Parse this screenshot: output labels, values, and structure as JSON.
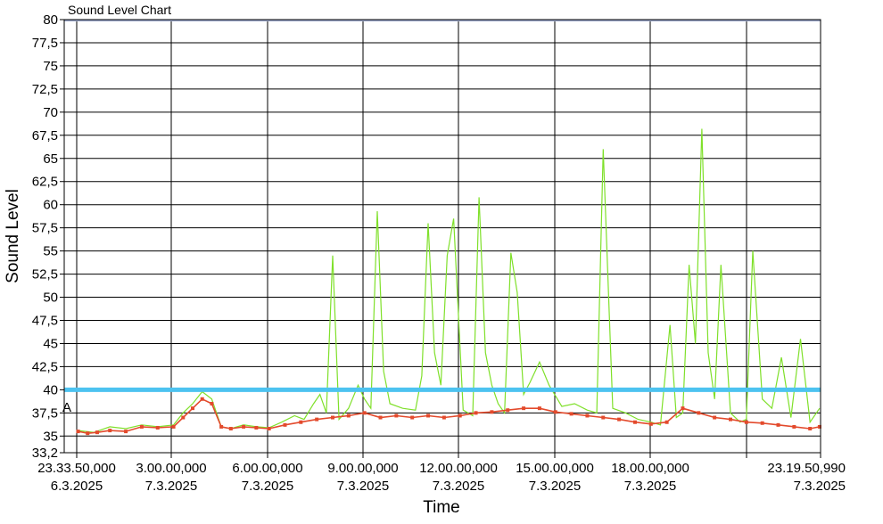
{
  "chart_data": {
    "type": "line",
    "title": "Sound Level Chart",
    "xlabel": "Time",
    "ylabel": "Sound Level",
    "ylim": [
      33.2,
      80
    ],
    "y_ticks": [
      "80",
      "77,5",
      "75",
      "72,5",
      "70",
      "67,5",
      "65",
      "62,5",
      "60",
      "57,5",
      "55",
      "52,5",
      "50",
      "47,5",
      "45",
      "42,5",
      "40",
      "37,5",
      "35",
      "33,2"
    ],
    "x_range_hours": [
      -0.4361,
      23.3308
    ],
    "x_ticks": [
      {
        "time": "23.33.50,000",
        "date": "6.3.2025"
      },
      {
        "time": "3.00.00,000",
        "date": "7.3.2025"
      },
      {
        "time": "6.00.00,000",
        "date": "7.3.2025"
      },
      {
        "time": "9.00.00,000",
        "date": "7.3.2025"
      },
      {
        "time": "12.00.00,000",
        "date": "7.3.2025"
      },
      {
        "time": "15.00.00,000",
        "date": "7.3.2025"
      },
      {
        "time": "18.00.00,000",
        "date": "7.3.2025"
      },
      {
        "time": "",
        "date": ""
      },
      {
        "time": "23.19.50,990",
        "date": "7.3.2025"
      }
    ],
    "threshold": {
      "value": 40,
      "color": "#4dc3f0"
    },
    "marker_label": "A",
    "series": [
      {
        "color": "#7fe02a",
        "x": [
          0,
          0.5,
          1,
          1.5,
          2,
          2.5,
          3,
          3.3,
          3.6,
          3.9,
          4.2,
          4.5,
          4.8,
          5.2,
          5.6,
          6.0,
          6.4,
          6.8,
          7.1,
          7.4,
          7.6,
          7.8,
          8.0,
          8.2,
          8.5,
          8.8,
          9.0,
          9.2,
          9.4,
          9.6,
          9.8,
          10.2,
          10.6,
          10.8,
          11.0,
          11.2,
          11.4,
          11.6,
          11.8,
          12.1,
          12.4,
          12.6,
          12.8,
          13.0,
          13.2,
          13.4,
          13.6,
          13.8,
          14.0,
          14.2,
          14.5,
          14.8,
          15.2,
          15.6,
          16.0,
          16.3,
          16.5,
          16.8,
          17.2,
          17.6,
          18.0,
          18.3,
          18.6,
          18.8,
          19.0,
          19.2,
          19.4,
          19.6,
          19.8,
          20.0,
          20.2,
          20.5,
          20.8,
          21.0,
          21.2,
          21.5,
          21.8,
          22.1,
          22.4,
          22.7,
          23.0,
          23.3
        ],
        "y": [
          35.6,
          35.4,
          36.0,
          35.8,
          36.2,
          36.0,
          36.2,
          37.5,
          38.5,
          39.8,
          39.0,
          36.0,
          35.8,
          36.2,
          36.0,
          35.9,
          36.5,
          37.2,
          36.8,
          38.5,
          39.5,
          37.5,
          54.5,
          36.8,
          38.0,
          40.5,
          39.0,
          38.0,
          59.3,
          42.0,
          38.5,
          38.0,
          37.8,
          41.5,
          58.0,
          44.0,
          40.5,
          54.5,
          58.5,
          37.8,
          37.2,
          60.8,
          44.0,
          40.5,
          38.5,
          37.5,
          54.8,
          50.5,
          39.5,
          40.8,
          43.0,
          40.5,
          38.2,
          38.5,
          37.8,
          37.5,
          66.0,
          38.0,
          37.5,
          36.8,
          36.5,
          36.2,
          47.0,
          37.0,
          37.5,
          53.5,
          45.0,
          68.2,
          44.0,
          39.0,
          53.5,
          37.5,
          36.5,
          36.8,
          55.0,
          39.0,
          38.0,
          43.5,
          37.0,
          45.5,
          36.5,
          38.0
        ]
      },
      {
        "color": "#e34a2c",
        "x": [
          0,
          0.3,
          0.6,
          1.0,
          1.5,
          2.0,
          2.5,
          3.0,
          3.3,
          3.6,
          3.9,
          4.2,
          4.5,
          4.8,
          5.2,
          5.6,
          6.0,
          6.5,
          7.0,
          7.5,
          8.0,
          8.5,
          9.0,
          9.5,
          10.0,
          10.5,
          11.0,
          11.5,
          12.0,
          12.5,
          13.0,
          13.5,
          14.0,
          14.5,
          15.0,
          15.5,
          16.0,
          16.5,
          17.0,
          17.5,
          18.0,
          18.5,
          19.0,
          19.5,
          20.0,
          20.5,
          21.0,
          21.5,
          22.0,
          22.5,
          23.0,
          23.3
        ],
        "y": [
          35.5,
          35.3,
          35.4,
          35.6,
          35.5,
          36.0,
          35.9,
          36.0,
          37.0,
          38.0,
          39.0,
          38.5,
          36.0,
          35.8,
          36.0,
          35.9,
          35.8,
          36.2,
          36.5,
          36.8,
          37.0,
          37.2,
          37.5,
          37.0,
          37.2,
          37.0,
          37.2,
          37.0,
          37.2,
          37.5,
          37.6,
          37.8,
          38.0,
          38.0,
          37.6,
          37.4,
          37.2,
          37.0,
          36.8,
          36.5,
          36.3,
          36.5,
          38.0,
          37.5,
          37.0,
          36.8,
          36.5,
          36.4,
          36.2,
          36.0,
          35.8,
          36.0
        ]
      }
    ],
    "grid": true
  }
}
